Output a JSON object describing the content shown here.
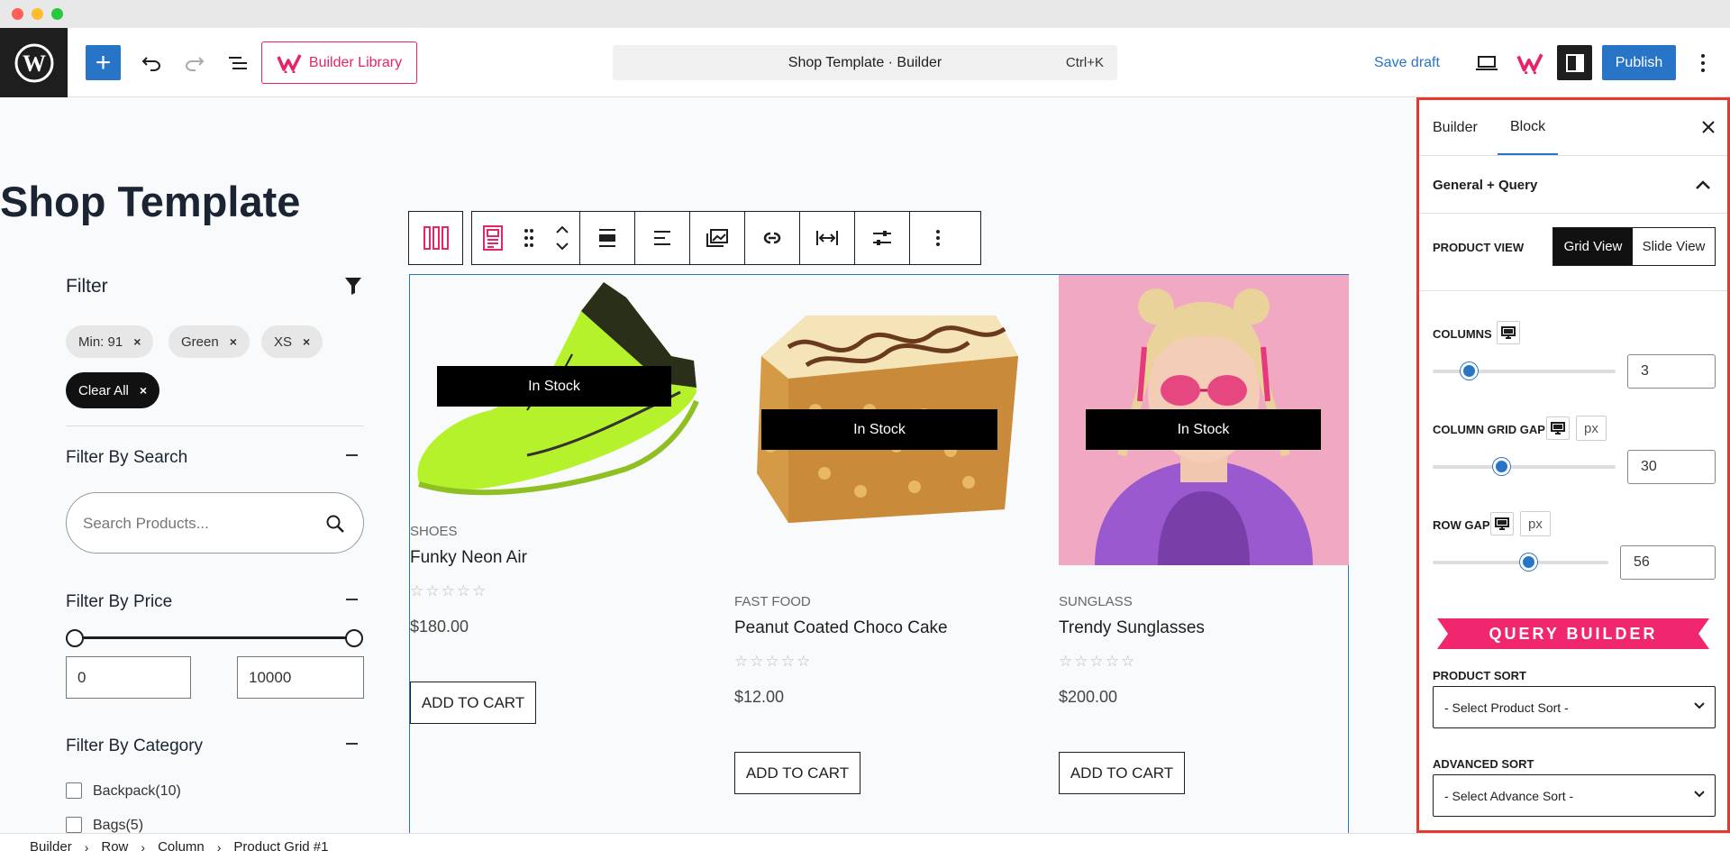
{
  "toolbar": {
    "builder_library": "Builder Library",
    "document_title": "Shop Template · Builder",
    "shortcut": "Ctrl+K",
    "save_draft": "Save draft",
    "publish": "Publish"
  },
  "page": {
    "title": "Shop Template"
  },
  "filters": {
    "heading": "Filter",
    "chips": [
      "Min: 91",
      "Green",
      "XS"
    ],
    "clear_all": "Clear All",
    "search_heading": "Filter By Search",
    "search_placeholder": "Search Products...",
    "price_heading": "Filter By Price",
    "price_min": "0",
    "price_max": "10000",
    "category_heading": "Filter By Category",
    "categories": [
      "Backpack(10)",
      "Bags(5)"
    ]
  },
  "products": [
    {
      "stock": "In Stock",
      "category": "SHOES",
      "name": "Funky Neon Air",
      "price": "$180.00",
      "button": "ADD TO CART",
      "stars": "☆☆☆☆☆"
    },
    {
      "stock": "In Stock",
      "category": "FAST FOOD",
      "name": "Peanut Coated Choco Cake",
      "price": "$12.00",
      "button": "ADD TO CART",
      "stars": "☆☆☆☆☆"
    },
    {
      "stock": "In Stock",
      "category": "SUNGLASS",
      "name": "Trendy Sunglasses",
      "price": "$200.00",
      "button": "ADD TO CART",
      "stars": "☆☆☆☆☆"
    }
  ],
  "inspector": {
    "tabs": [
      "Builder",
      "Block"
    ],
    "section_title": "General + Query",
    "product_view_label": "PRODUCT VIEW",
    "view_options": [
      "Grid View",
      "Slide View"
    ],
    "columns_label": "COLUMNS",
    "columns_value": "3",
    "column_gap_label": "COLUMN GRID GAP",
    "column_gap_unit": "px",
    "column_gap_value": "30",
    "row_gap_label": "ROW GAP",
    "row_gap_unit": "px",
    "row_gap_value": "56",
    "query_banner": "QUERY BUILDER",
    "product_sort_label": "PRODUCT SORT",
    "product_sort_value": "- Select Product Sort -",
    "advanced_sort_label": "ADVANCED SORT",
    "advanced_sort_value": "- Select Advance Sort -",
    "columns_slider_level": 0.2,
    "column_gap_slider_level": 0.38,
    "row_gap_slider_level": 0.55
  },
  "breadcrumb": [
    "Builder",
    "Row",
    "Column",
    "Product Grid #1"
  ],
  "colors": {
    "accent_blue": "#2874c7",
    "brand_pink": "#e5246a",
    "highlight_red": "#e5392f"
  }
}
